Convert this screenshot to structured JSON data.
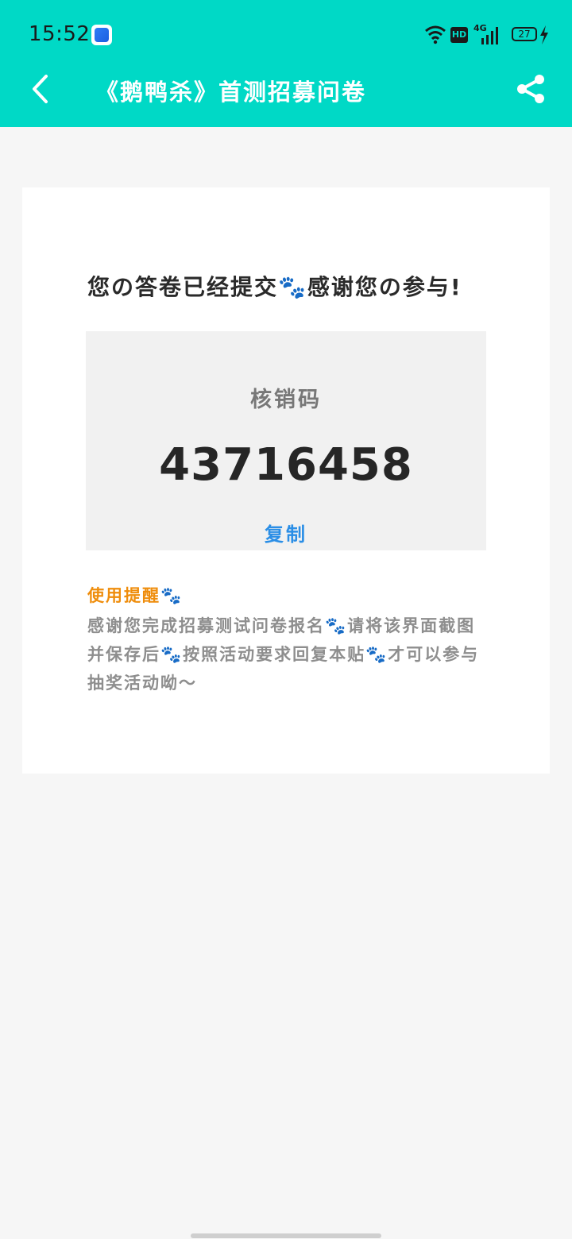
{
  "status_bar": {
    "time": "15:52",
    "hd_label": "HD",
    "network_label": "4G",
    "battery_level": "27",
    "icons": [
      "app-badge-icon",
      "wifi-icon",
      "hd-icon",
      "signal-icon",
      "battery-icon",
      "charging-icon"
    ]
  },
  "nav": {
    "title": "《鹅鸭杀》首测招募问卷",
    "back_icon": "chevron-left-icon",
    "share_icon": "share-icon"
  },
  "card": {
    "success_message": "您の答卷已经提交🐾感谢您の参与!",
    "code_label": "核销码",
    "code_value": "43716458",
    "copy_label": "复制",
    "tip_title": "使用提醒🐾",
    "tip_body": "感谢您完成招募测试问卷报名🐾请将该界面截图并保存后🐾按照活动要求回复本贴🐾才可以参与抽奖活动呦～"
  },
  "colors": {
    "header_bg": "#00d9c6",
    "accent_blue": "#2a8ee6",
    "tip_orange": "#ef8d0c",
    "page_bg": "#f6f6f6"
  }
}
